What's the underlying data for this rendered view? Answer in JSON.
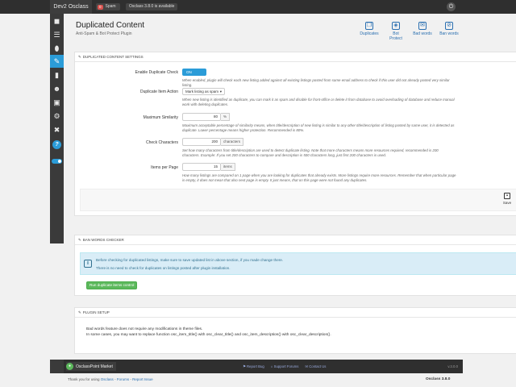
{
  "topbar": {
    "brand": "Dev2 Osclass",
    "spam_count": "0",
    "spam_label": "Spam",
    "available": "Osclass 3.8.0 is available"
  },
  "sidebar": {
    "icons": [
      "dashboard-icon",
      "list-icon",
      "tag-icon",
      "plugin-icon",
      "stats-icon",
      "users-icon",
      "pages-icon",
      "settings-icon",
      "tools-icon",
      "help-icon",
      "toggle-icon"
    ]
  },
  "header": {
    "title": "Duplicated Content",
    "subtitle": "Anti-Spam & Bot Protect Plugin",
    "tabs": [
      {
        "label": "Duplicates",
        "icon": "duplicates-icon"
      },
      {
        "label": "Bot Protect",
        "icon": "shield-icon"
      },
      {
        "label": "Bad words",
        "icon": "comment-icon"
      },
      {
        "label": "Ban words",
        "icon": "ban-icon"
      }
    ]
  },
  "settings": {
    "heading": "DUPLICATED CONTENT SETTINGS",
    "enable": {
      "label": "Enable Duplicate Check",
      "value": "ON",
      "help": "When enabled, plugin will check each new listing added against all existing listings posted from same email address to check if this user did not already posted very similar listing."
    },
    "action": {
      "label": "Duplicate Item Action",
      "value": "Mark listing as spam",
      "help": "When new listing is identified as duplicate, you can mark it as spam and disable for front-office or delete it from database to avoid overloading of database and reduce manual work with deleting duplicates."
    },
    "similarity": {
      "label": "Maximum Similarity",
      "value": "80",
      "unit": "%",
      "help": "Maximum acceptable percentage of similarity means, when title/description of new listing is similar to any other title/description of listing posted by same user, it is detected as duplicate. Lower percentage means higher protection. Recommended is 80%."
    },
    "chars": {
      "label": "Check Characters",
      "value": "200",
      "unit": "characters",
      "help": "Set how many characters from title/description are used to detect duplicate listing. Note that more characters means more resources required, recommended is 200 characters. Example: If you set 200 characters to compare and description is 500 characters long, just first 200 characters is used."
    },
    "perpage": {
      "label": "Items per Page",
      "value": "15",
      "unit": "items",
      "help": "How many listings are compared on 1 page when you are looking for duplicates that already exists. More listings require more resources. Remember that when particular page is empty, it does not mean that also next page is empty. It just means, that on this page were not found any duplicates."
    },
    "save_label": "Save"
  },
  "ban_checker": {
    "heading": "BAN WORDS CHECKER",
    "alert_line1": "Before checking for duplicated listings, make sure to save updated list in above section, if you made change there.",
    "alert_line2": "There is no need to check for duplicates on listings posted after plugin installation.",
    "run_button": "Run duplicate items control"
  },
  "plugin_setup": {
    "heading": "PLUGIN SETUP",
    "line1": "Bad words feature does not require any modifications in theme files.",
    "line2": "In some cases, you may want to replace function osc_item_title() with osc_clear_title() and osc_item_description() with osc_clear_description()."
  },
  "footer": {
    "brand": "OsclassPoint Market",
    "links": [
      "Report Bug",
      "Support Forums",
      "Contact Us"
    ],
    "version": "v.3.0.0"
  },
  "bottom": {
    "thanks": "Thank you for using",
    "link1": "Osclass",
    "sep1": " - ",
    "link2": "Forums",
    "sep2": " - ",
    "link3": "Report Issue",
    "version": "Osclass 3.8.0"
  }
}
